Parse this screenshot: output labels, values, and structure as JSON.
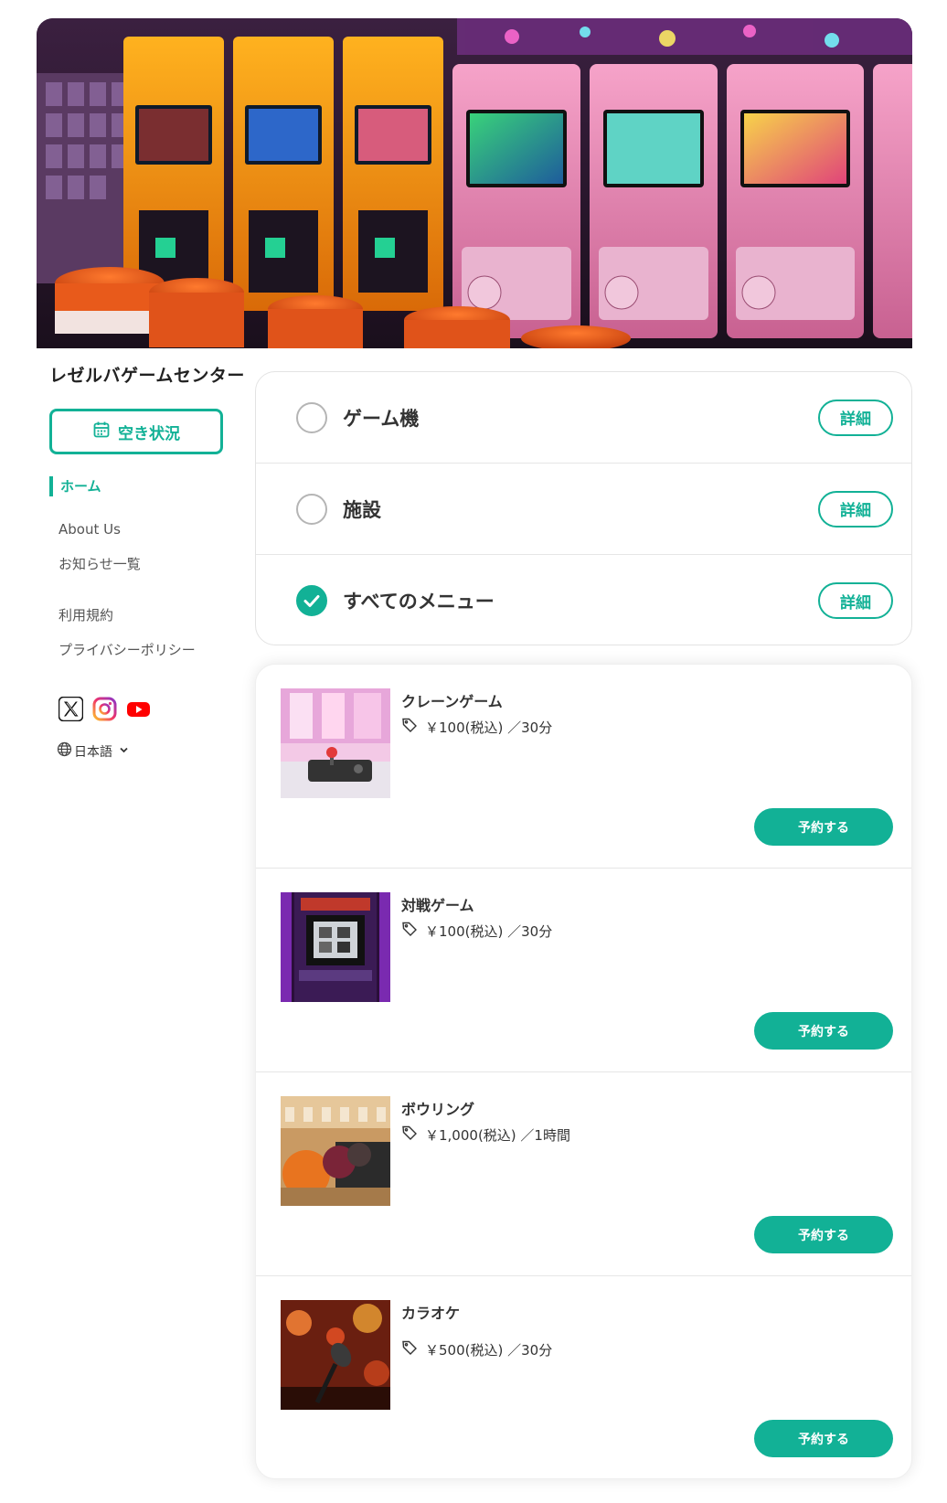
{
  "shop": {
    "name": "レゼルバゲームセンター"
  },
  "sidebar": {
    "availability_label": "空き状況",
    "nav": {
      "home": "ホーム",
      "about": "About Us",
      "news": "お知らせ一覧",
      "terms": "利用規約",
      "privacy": "プライバシーポリシー"
    },
    "social_icons": [
      "x-icon",
      "instagram-icon",
      "youtube-icon"
    ],
    "language": "日本語"
  },
  "categories": [
    {
      "label": "ゲーム機",
      "checked": false,
      "detail_label": "詳細"
    },
    {
      "label": "施設",
      "checked": false,
      "detail_label": "詳細"
    },
    {
      "label": "すべてのメニュー",
      "checked": true,
      "detail_label": "詳細"
    }
  ],
  "menu_items": [
    {
      "name": "クレーンゲーム",
      "price": "￥100(税込) ／30分",
      "button": "予約する"
    },
    {
      "name": "対戦ゲーム",
      "price": "￥100(税込) ／30分",
      "button": "予約する"
    },
    {
      "name": "ボウリング",
      "price": "￥1,000(税込) ／1時間",
      "button": "予約する"
    },
    {
      "name": "カラオケ",
      "price": "￥500(税込) ／30分",
      "button": "予約する"
    }
  ],
  "colors": {
    "accent": "#12b196",
    "border": "#e3e3e3",
    "text": "#333333"
  }
}
